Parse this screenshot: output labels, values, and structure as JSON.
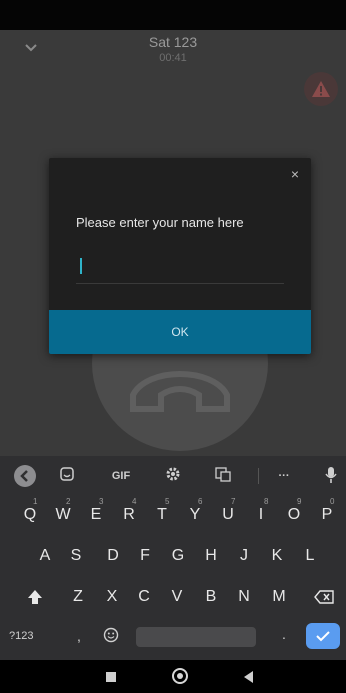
{
  "call": {
    "caller_name": "Sat 123",
    "timer": "00:41",
    "collapse_icon": "chevron-down-icon",
    "warning_icon": "warning-triangle-icon",
    "avatar_icon": "phone-handset-icon"
  },
  "dialog": {
    "close_glyph": "×",
    "prompt": "Please enter your name here",
    "input_value": "",
    "ok_label": "OK"
  },
  "keyboard": {
    "toolbar": {
      "back_icon": "chevron-left-icon",
      "sticker_icon": "sticker-icon",
      "gif_label": "GIF",
      "settings_icon": "gear-icon",
      "translate_icon": "translate-icon",
      "more_label": "···",
      "mic_icon": "mic-icon"
    },
    "row1": [
      {
        "key": "Q",
        "hint": "1"
      },
      {
        "key": "W",
        "hint": "2"
      },
      {
        "key": "E",
        "hint": "3"
      },
      {
        "key": "R",
        "hint": "4"
      },
      {
        "key": "T",
        "hint": "5"
      },
      {
        "key": "Y",
        "hint": "6"
      },
      {
        "key": "U",
        "hint": "7"
      },
      {
        "key": "I",
        "hint": "8"
      },
      {
        "key": "O",
        "hint": "9"
      },
      {
        "key": "P",
        "hint": "0"
      }
    ],
    "row2": [
      "A",
      "S",
      "D",
      "F",
      "G",
      "H",
      "J",
      "K",
      "L"
    ],
    "row3": [
      "Z",
      "X",
      "C",
      "V",
      "B",
      "N",
      "M"
    ],
    "symbols_label": "?123",
    "comma_label": ",",
    "period_label": ".",
    "shift_icon": "shift-arrow-icon",
    "backspace_icon": "backspace-icon",
    "emoji_icon": "emoji-icon",
    "done_icon": "checkmark-icon"
  },
  "navigation": {
    "recents_icon": "square-icon",
    "home_icon": "circle-icon",
    "back_icon": "triangle-back-icon"
  },
  "colors": {
    "dialog_button": "#066a8f",
    "input_caret": "#2fb3c9",
    "done_key": "#5a9cf0"
  }
}
